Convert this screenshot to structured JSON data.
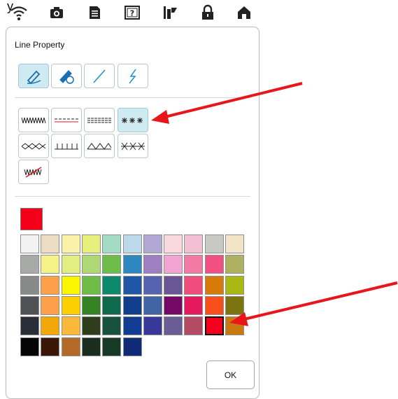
{
  "top_cut_text": "y",
  "status_bar": {
    "icons": [
      "wifi-icon",
      "camera-icon",
      "document-icon",
      "help-icon",
      "embroidery-icon",
      "lock-icon",
      "home-icon"
    ]
  },
  "dialog": {
    "title": "Line Property",
    "ok_label": "OK"
  },
  "line_tools": [
    {
      "name": "pen-icon",
      "selected": true
    },
    {
      "name": "pen-circle-icon",
      "selected": false
    },
    {
      "name": "straight-line-icon",
      "selected": false
    },
    {
      "name": "zigzag-line-icon",
      "selected": false
    }
  ],
  "stitch_types": [
    {
      "name": "zigzag-stitch-icon",
      "selected": false
    },
    {
      "name": "running-stitch-icon",
      "selected": false
    },
    {
      "name": "triple-stitch-icon",
      "selected": false
    },
    {
      "name": "star-stitch-icon",
      "selected": true
    },
    {
      "name": "diamond-stitch-icon",
      "selected": false
    },
    {
      "name": "blanket-stitch-icon",
      "selected": false
    },
    {
      "name": "triangle-stitch-icon",
      "selected": false
    },
    {
      "name": "cross-stitch-icon",
      "selected": false
    },
    {
      "name": "no-stitch-icon",
      "selected": false
    }
  ],
  "current_color": "#f5001a",
  "palette": [
    [
      "#f2f2f2",
      "#ecdcc4",
      "#fbf1a8",
      "#e8f07c",
      "#a4dbc6",
      "#bdd8ea",
      "#b2a8d6",
      "#fbd8dc",
      "#f3bfd3",
      "#c8c8c4",
      "#f2e4c6"
    ],
    [
      "#a8aaa8",
      "#f6f28a",
      "#e2ee82",
      "#aed873",
      "#6cbd4a",
      "#2f87c0",
      "#9e7fbf",
      "#f2a5d2",
      "#f27aa3",
      "#f05084",
      "#aeb062"
    ],
    [
      "#888a8a",
      "#fca04a",
      "#fcf500",
      "#6ebd46",
      "#0d8a6e",
      "#2056a6",
      "#5663ae",
      "#6a5694",
      "#f04c7c",
      "#d67a0a",
      "#aab814"
    ],
    [
      "#4e5254",
      "#fca04a",
      "#fcd000",
      "#348424",
      "#0e6a4c",
      "#0e3e8c",
      "#4264a4",
      "#760866",
      "#e6185e",
      "#f74e1c",
      "#7c7410"
    ],
    [
      "#2a2e38",
      "#f2a808",
      "#fcb838",
      "#2e3e1a",
      "#17523e",
      "#103c94",
      "#38389a",
      "#6a5c96",
      "#b44a64",
      "#f5001a",
      "#c87a10"
    ],
    [
      "#050505",
      "#3a1606",
      "#b36a26",
      "#1a2e1e",
      "#173a26",
      "#102a76"
    ]
  ],
  "selected_color": "#f5001a"
}
